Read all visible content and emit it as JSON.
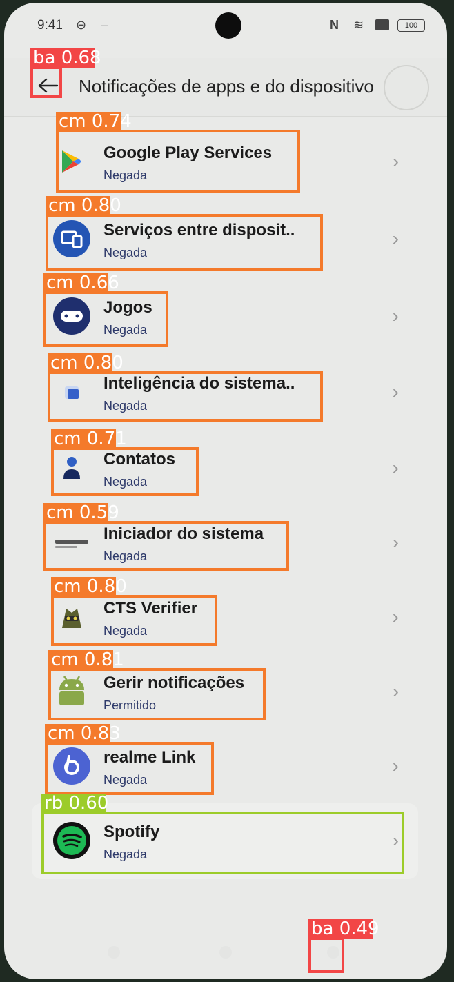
{
  "status_bar": {
    "time": "9:41",
    "battery": "100"
  },
  "header": {
    "title": "Notificações de apps e do dispositivo"
  },
  "apps": [
    {
      "name": "Google Play Services",
      "status": "Negada",
      "icon": "google-play-services-icon"
    },
    {
      "name": "Serviços entre disposit..",
      "status": "Negada",
      "icon": "cross-device-services-icon"
    },
    {
      "name": "Jogos",
      "status": "Negada",
      "icon": "gamepad-icon"
    },
    {
      "name": "Inteligência do sistema..",
      "status": "Negada",
      "icon": "system-intelligence-icon"
    },
    {
      "name": "Contatos",
      "status": "Negada",
      "icon": "contacts-icon"
    },
    {
      "name": "Iniciador do sistema",
      "status": "Negada",
      "icon": "realme-launcher-icon"
    },
    {
      "name": "CTS Verifier",
      "status": "Negada",
      "icon": "cts-verifier-icon"
    },
    {
      "name": "Gerir notificações",
      "status": "Permitido",
      "icon": "android-icon"
    },
    {
      "name": "realme Link",
      "status": "Negada",
      "icon": "realme-link-icon"
    },
    {
      "name": "Spotify",
      "status": "Negada",
      "icon": "spotify-icon"
    }
  ],
  "detections": [
    {
      "label": "ba 0.68"
    },
    {
      "label": "cm 0.74"
    },
    {
      "label": "cm 0.80"
    },
    {
      "label": "cm 0.66"
    },
    {
      "label": "cm 0.80"
    },
    {
      "label": "cm 0.71"
    },
    {
      "label": "cm 0.59"
    },
    {
      "label": "cm 0.80"
    },
    {
      "label": "cm 0.81"
    },
    {
      "label": "cm 0.83"
    },
    {
      "label": "rb 0.60"
    },
    {
      "label": "ba 0.49"
    }
  ],
  "colors": {
    "cm": "#f47a2b",
    "ba": "#f24646",
    "rb": "#9ccc2a"
  }
}
